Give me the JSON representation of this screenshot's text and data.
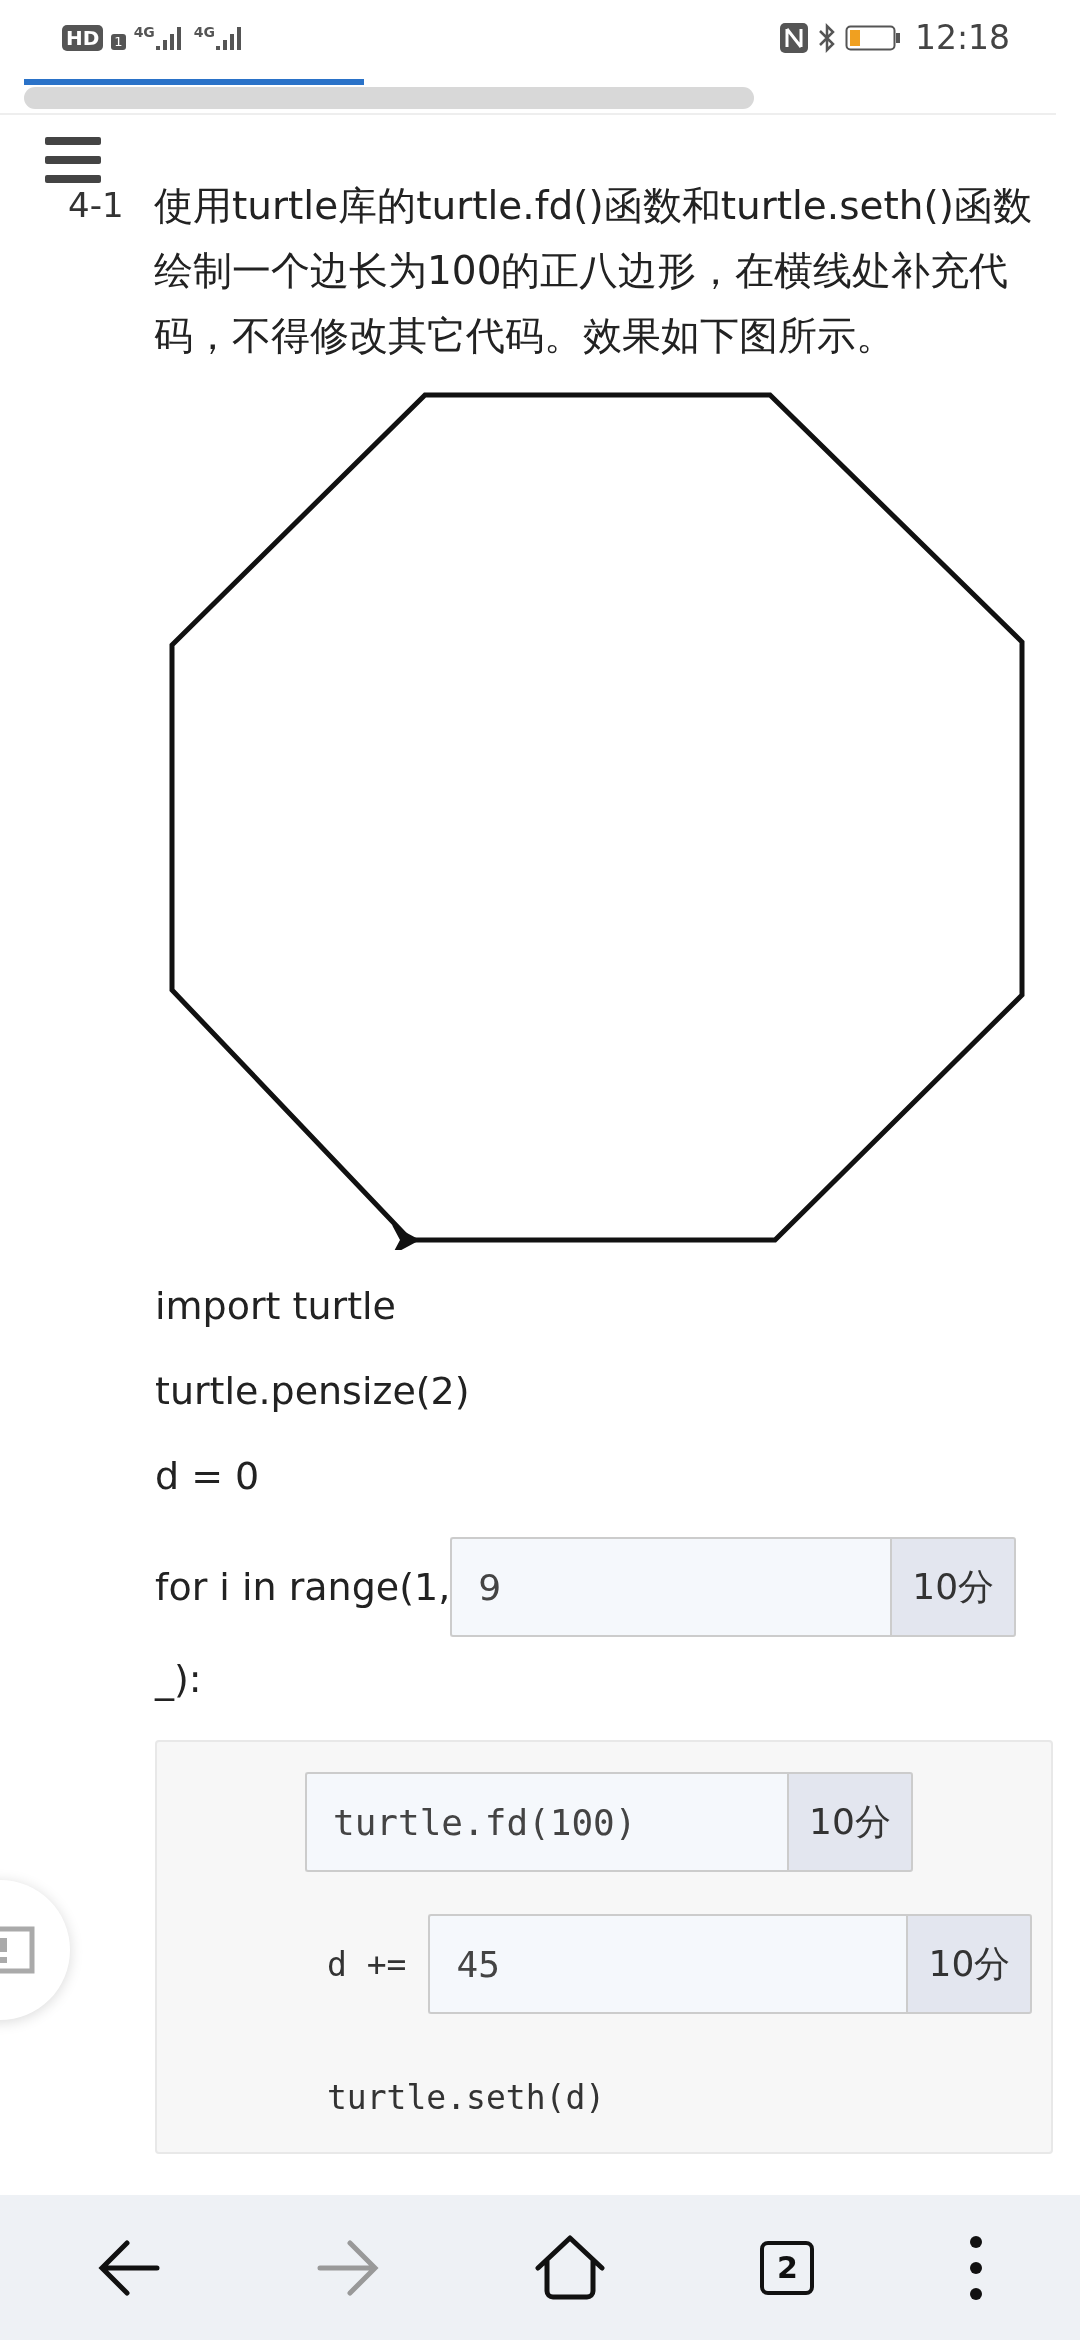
{
  "status_bar": {
    "badges": [
      "HD",
      "1"
    ],
    "networks": [
      "4G",
      "4G"
    ],
    "time": "12:18"
  },
  "question": {
    "number": "4-1",
    "text": "使用turtle库的turtle.fd()函数和turtle.seth()函数绘制一个边长为100的正八边形，在横线处补充代码，不得修改其它代码。效果如下图所示。"
  },
  "code": [
    {
      "kind": "text",
      "text": "import turtle"
    },
    {
      "kind": "text",
      "text": "turtle.pensize(2)"
    },
    {
      "kind": "text",
      "text": "d = 0"
    },
    {
      "kind": "blank",
      "prefix": "for i in range(1,",
      "value": "9",
      "score": "10分"
    },
    {
      "kind": "text",
      "text": "_):"
    }
  ],
  "loop_body": [
    {
      "kind": "blank",
      "value": "turtle.fd(100)",
      "score": "10分"
    },
    {
      "kind": "blank",
      "prefix": "d +=",
      "value": "45",
      "score": "10分"
    },
    {
      "kind": "text",
      "text": "turtle.seth(d)"
    }
  ],
  "nav": [
    {
      "kind": "back",
      "disabled": false
    },
    {
      "kind": "forward",
      "disabled": true
    },
    {
      "kind": "home",
      "disabled": false
    },
    {
      "kind": "tabs",
      "count": "2",
      "disabled": false
    },
    {
      "kind": "menu",
      "disabled": false
    }
  ]
}
